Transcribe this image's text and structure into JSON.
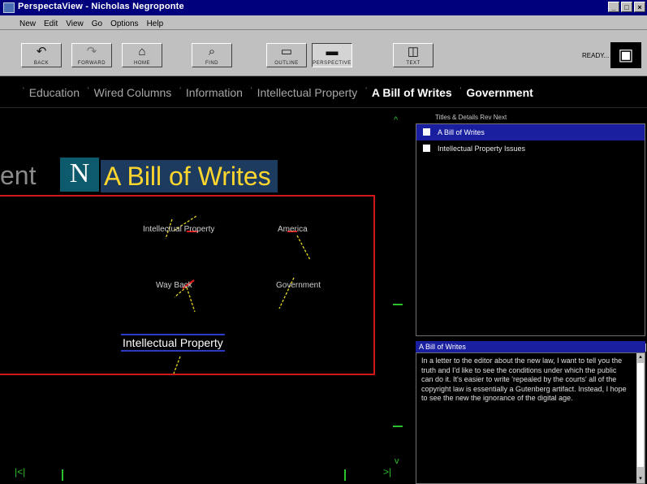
{
  "window": {
    "title": "PerspectaView - Nicholas Negroponte",
    "controls": [
      "_",
      "□",
      "×"
    ]
  },
  "menu": {
    "items": [
      "New",
      "Edit",
      "View",
      "Go",
      "Options",
      "Help"
    ]
  },
  "toolbar": {
    "buttons": [
      {
        "label": "BACK",
        "icon": "back-icon"
      },
      {
        "label": "FORWARD",
        "icon": "forward-icon"
      },
      {
        "label": "HOME",
        "icon": "home-icon"
      },
      {
        "label": "FIND",
        "icon": "find-icon"
      },
      {
        "label": "OUTLINE",
        "icon": "outline-icon"
      },
      {
        "label": "PERSPECTIVE",
        "icon": "perspective-icon"
      },
      {
        "label": "TEXT",
        "icon": "text-icon"
      }
    ],
    "status": "READY..."
  },
  "breadcrumb": {
    "items": [
      "Education",
      "Wired Columns",
      "Information",
      "Intellectual Property",
      "A Bill of Writes",
      "Government"
    ],
    "active_index": 4
  },
  "canvas": {
    "title_prefix": "ent",
    "logo_letter": "N",
    "title": "A Bill of Writes",
    "nodes": {
      "n1": "Intellectual Property",
      "n2": "America",
      "n3": "Way Back",
      "n4": "Government"
    },
    "main_node": "Intellectual Property",
    "nav_up": "^",
    "nav_down": "v",
    "nav_left": "|<|",
    "nav_right": ">|"
  },
  "panel": {
    "list_header": "Titles & Details    Rev    Next",
    "list_items": [
      {
        "label": "A Bill of Writes",
        "selected": true
      },
      {
        "label": "Intellectual Property Issues",
        "selected": false
      }
    ],
    "description_title": "A Bill of Writes",
    "description": "In a letter to the editor about the new law, I want to tell you the truth and I'd like to see the conditions under which the public can do it. It's easier to write 'repealed by the courts' all of the copyright law is essentially a Gutenberg artifact. Instead, I hope to see the new the ignorance of the digital age."
  },
  "colors": {
    "title_bar": "#00007c",
    "selection": "#1a1fa0",
    "title_text": "#ffd62e",
    "map_border": "#d01818",
    "accent_green": "#2cbf2c"
  }
}
